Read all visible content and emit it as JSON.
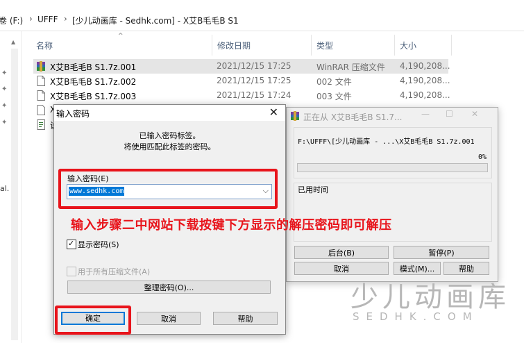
{
  "address": {
    "drive": "卷 (F:)",
    "folder1": "UFFF",
    "folder2": "[少儿动画库 - Sedhk.com] - X艾B毛毛B S1"
  },
  "left_pane": {
    "truncated_label": "al."
  },
  "columns": {
    "name": "名称",
    "date": "修改日期",
    "type": "类型",
    "size": "大小"
  },
  "files": [
    {
      "name": "X艾B毛毛B S1.7z.001",
      "date": "2021/12/15 17:25",
      "type": "WinRAR 压缩文件",
      "size": "4,190,208...",
      "icon": "winrar-archive-icon"
    },
    {
      "name": "X艾B毛毛B S1.7z.002",
      "date": "2021/12/15 17:25",
      "type": "002 文件",
      "size": "4,190,208...",
      "icon": "file-icon"
    },
    {
      "name": "X艾B毛毛B S1.7z.003",
      "date": "2021/12/15 17:24",
      "type": "003 文件",
      "size": "4,190,208...",
      "icon": "file-icon"
    },
    {
      "name": "X",
      "icon": "file-icon"
    },
    {
      "name": "说",
      "icon": "text-doc-icon"
    }
  ],
  "password_dialog": {
    "title": "输入密码",
    "info_line1": "已输入密码标签。",
    "info_line2": "将使用匹配此标签的密码。",
    "input_label": "输入密码(E)",
    "input_value": "www.sedhk.com",
    "show_password": "显示密码(S)",
    "use_for_all": "用于所有压缩文件(A)",
    "organize": "整理密码(O)...",
    "ok": "确定",
    "cancel": "取消",
    "help": "帮助",
    "show_password_checked": true,
    "use_for_all_checked": false
  },
  "annotation": {
    "text": "输入步骤二中网站下载按键下方显示的解压密码即可解压",
    "color": "#e8141b"
  },
  "extract_window": {
    "title": "正在从 X艾B毛毛B S1.7...",
    "path": "F:\\UFFF\\[少儿动画库 - ...\\X艾B毛毛B S1.7z.001",
    "percent_label": "0%",
    "progress": 0,
    "elapsed_label": "已用时间",
    "buttons": {
      "background": "后台(B)",
      "pause": "暂停(P)",
      "cancel": "取消",
      "mode": "模式(M)...",
      "help": "帮助"
    }
  },
  "watermark": {
    "main": "少儿动画库",
    "sub": "SEDHK.COM"
  }
}
